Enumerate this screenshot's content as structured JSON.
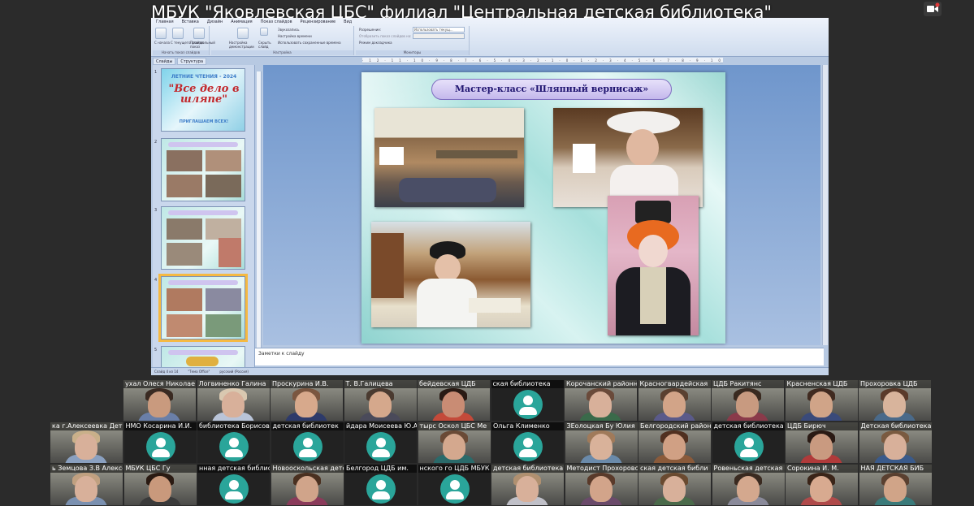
{
  "window": {
    "title": "МБУК \"Яковлевская ЦБС\" филиал \"Центральная детская библиотека\""
  },
  "ppt": {
    "ribbon_tabs": [
      "Главная",
      "Вставка",
      "Дизайн",
      "Анимация",
      "Показ слайдов",
      "Рецензирование",
      "Вид"
    ],
    "groups": {
      "start_slideshow": "Начать показ слайдов",
      "setup": "Настройка",
      "monitors": "Мониторы"
    },
    "buttons": {
      "from_start": "С начала",
      "from_current": "С текущего слайда",
      "custom_show": "Произвольный показ",
      "setup_show": "Настройка демонстрации",
      "hide_slide": "Скрыть слайд",
      "record_narration": "Звукозапись",
      "rehearse_timings": "Настройка времени",
      "use_timings": "Использовать сохраненные времена",
      "resolution": "Разрешение:",
      "resolution_value": "Использовать текущ...",
      "show_on": "Отобразить показ слайдов на:",
      "presenter_view": "Режим докладчика"
    },
    "panel_tabs": [
      "Слайды",
      "Структура"
    ],
    "thumbnails": [
      {
        "num": "1",
        "title": "\"Все дело в шляпе\"",
        "subtitle": "ЛЕТНИЕ ЧТЕНИЯ - 2024",
        "footer": "ПРИГЛАШАЕМ ВСЕХ!"
      },
      {
        "num": "2"
      },
      {
        "num": "3"
      },
      {
        "num": "4"
      },
      {
        "num": "5"
      }
    ],
    "slide": {
      "title": "Мастер-класс «Шляпный вернисаж»"
    },
    "notes_placeholder": "Заметки к слайду",
    "status": [
      "Слайд 4 из 14",
      "\"Тема Office\"",
      "русский (Россия)"
    ]
  },
  "participants": [
    {
      "name": "ухал Олеся Николае",
      "video": true,
      "skin": "#c99a7e",
      "hair": "#3a2a22",
      "shirt": "#6a7fa8"
    },
    {
      "name": "Логвиненко Галина",
      "video": true,
      "skin": "#d8b09a",
      "hair": "#d9c8b0",
      "shirt": "#b9c4d8"
    },
    {
      "name": "Проскурина И.В.",
      "video": true,
      "skin": "#d7a98c",
      "hair": "#7a5640",
      "shirt": "#2d3a6a"
    },
    {
      "name": "Т. В.Галицева",
      "video": true,
      "skin": "#d5a88c",
      "hair": "#4a3a30",
      "shirt": "#4a4a5a"
    },
    {
      "name": "бейдевская ЦДБ",
      "video": true,
      "skin": "#c98c74",
      "hair": "#2a1a14",
      "shirt": "#c44a3a"
    },
    {
      "name": "ская библиотека",
      "video": false
    },
    {
      "name": "Корочанский районн",
      "video": true,
      "skin": "#d8b09a",
      "hair": "#6a4a3a",
      "shirt": "#3a6a4a"
    },
    {
      "name": "Красногвардейская",
      "video": true,
      "skin": "#d2a488",
      "hair": "#5a4030",
      "shirt": "#5a5a8a"
    },
    {
      "name": "ЦДБ Ракитянс",
      "video": true,
      "skin": "#c89a80",
      "hair": "#3a2a20",
      "shirt": "#8a3a4a"
    },
    {
      "name": "Красненская ЦДБ",
      "video": true,
      "skin": "#d0a488",
      "hair": "#402a20",
      "shirt": "#3a4a7a"
    },
    {
      "name": "Прохоровка ЦДБ",
      "video": true,
      "skin": "#d8b49c",
      "hair": "#5a3a2a",
      "shirt": "#4a6a8a"
    },
    {
      "name": "ка г.Алексеевка Дет",
      "video": true,
      "skin": "#d8b09a",
      "hair": "#c9b08a",
      "shirt": "#8aa0c0"
    },
    {
      "name": "НМО Косарина И.И.",
      "video": false
    },
    {
      "name": "библиотека Борисовская",
      "video": false
    },
    {
      "name": "детская библиотек",
      "video": false
    },
    {
      "name": "йдарa Моисеева Ю.А",
      "video": false
    },
    {
      "name": "тырс Оскол ЦБС Ме",
      "video": true,
      "skin": "#d4a88e",
      "hair": "#6a4a36",
      "shirt": "#2a6a6a"
    },
    {
      "name": "Ольга Клименко",
      "video": false
    },
    {
      "name": "ЗЕолоцкая Бу Юлия",
      "video": true,
      "skin": "#d9b29a",
      "hair": "#a07a5a",
      "shirt": "#6a8aaa"
    },
    {
      "name": "Белгородский район",
      "video": true,
      "skin": "#d0a084",
      "hair": "#503020",
      "shirt": "#8a5a3a"
    },
    {
      "name": "детская библиотека",
      "video": false
    },
    {
      "name": "ЦДБ Бирюч",
      "video": true,
      "skin": "#c99a80",
      "hair": "#2a1a14",
      "shirt": "#b03a3a"
    },
    {
      "name": "Детская библиотека",
      "video": true,
      "skin": "#d8b09a",
      "hair": "#7a5a40",
      "shirt": "#3a5a8a"
    },
    {
      "name": "ь Земцова З.В Алексе",
      "video": true,
      "skin": "#d8b09a",
      "hair": "#c0a080",
      "shirt": "#7a90b0"
    },
    {
      "name": "МБУК ЦБС Гу",
      "video": true,
      "skin": "#c9997c",
      "hair": "#2a1a12",
      "shirt": "#3a3a3a"
    },
    {
      "name": "нная детская библио",
      "video": false
    },
    {
      "name": "Новооскольская детс",
      "video": true,
      "skin": "#d0a48a",
      "hair": "#4a3020",
      "shirt": "#8a3a5a"
    },
    {
      "name": "Белгород ЦДБ им.",
      "video": false
    },
    {
      "name": "нского го ЦДБ МБУК",
      "video": false
    },
    {
      "name": "детская библиотека",
      "video": true,
      "skin": "#d8b09a",
      "hair": "#b09070",
      "shirt": "#c0c0c8"
    },
    {
      "name": "Методист Прохоровск",
      "video": true,
      "skin": "#d2a48a",
      "hair": "#5a3a2a",
      "shirt": "#6a4a6a"
    },
    {
      "name": "ская детская библи",
      "video": true,
      "skin": "#d8b09a",
      "hair": "#6a4a30",
      "shirt": "#4a6a4a"
    },
    {
      "name": "Ровеньская детская",
      "video": true,
      "skin": "#d4a88e",
      "hair": "#3a2a20",
      "shirt": "#8a8a9a"
    },
    {
      "name": "Сорокина И. М.",
      "video": true,
      "skin": "#d8aa90",
      "hair": "#3a2418",
      "shirt": "#b04a4a"
    },
    {
      "name": "НАЯ ДЕТСКАЯ БИБ",
      "video": true,
      "skin": "#d0a488",
      "hair": "#5a4030",
      "shirt": "#3a7a7a"
    }
  ]
}
